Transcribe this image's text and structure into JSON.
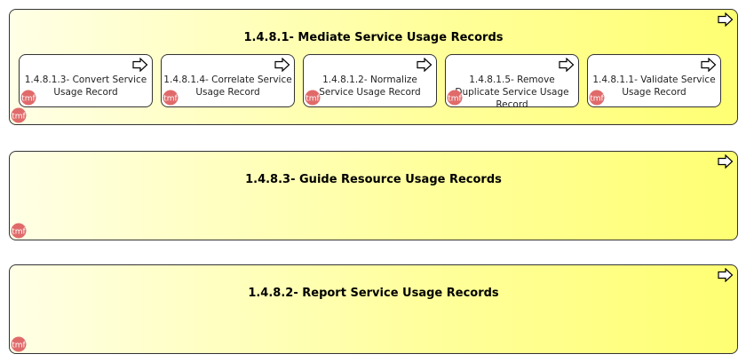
{
  "badge_text": "tmf",
  "colors": {
    "badge_fill": "#e06a6a",
    "badge_text": "#ffffff",
    "process_fill_start": "#ffffe6",
    "process_fill_end": "#ffff73",
    "border": "#333333"
  },
  "icons": {
    "process_marker": "right-arrow-outline-icon",
    "badge": "tmf-badge-icon"
  },
  "processes": [
    {
      "title": "1.4.8.1- Mediate Service Usage Records",
      "subprocesses": [
        {
          "label": "1.4.8.1.3- Convert Service Usage Record"
        },
        {
          "label": "1.4.8.1.4- Correlate Service Usage Record"
        },
        {
          "label": "1.4.8.1.2- Normalize Service Usage Record"
        },
        {
          "label": "1.4.8.1.5- Remove Duplicate Service Usage Record"
        },
        {
          "label": "1.4.8.1.1- Validate Service Usage Record"
        }
      ]
    },
    {
      "title": "1.4.8.3- Guide Resource Usage Records",
      "subprocesses": []
    },
    {
      "title": "1.4.8.2- Report Service Usage Records",
      "subprocesses": []
    }
  ]
}
